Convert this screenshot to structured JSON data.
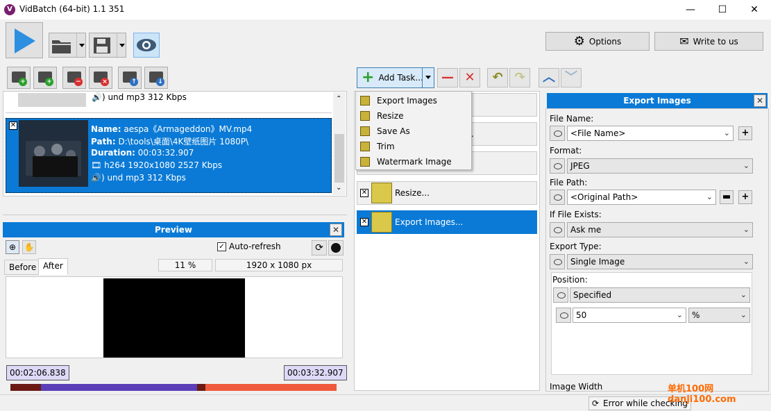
{
  "window": {
    "title": "VidBatch (64-bit) 1.1 351",
    "app_icon": "V",
    "minimize": "—",
    "maximize": "☐",
    "close": "✕"
  },
  "toolbar": {
    "options_label": "Options",
    "write_label": "Write to us"
  },
  "file_list": {
    "prev_item_audio": "🔊) und mp3 312 Kbps",
    "selected": {
      "checkbox": "✕",
      "name_label": "Name:",
      "name_value": "aespa《Armageddon》MV.mp4",
      "path_label": "Path:",
      "path_value": "D:\\tools\\桌面\\4K壁纸图片 1080P\\",
      "duration_label": "Duration:",
      "duration_value": "00:03:32.907",
      "video": "h264 1920x1080 2527 Kbps",
      "audio": "und mp3 312 Kbps"
    }
  },
  "preview": {
    "title": "Preview",
    "auto_refresh_label": "Auto-refresh",
    "zoom": "11 %",
    "resolution": "1920 x 1080 px",
    "tab_before": "Before",
    "tab_after": "After",
    "time_start": "00:02:06.838",
    "time_end": "00:03:32.907"
  },
  "tasks": {
    "add_task_label": "Add Task...",
    "menu": [
      "Export Images",
      "Resize",
      "Save As",
      "Trim",
      "Watermark Image"
    ],
    "partial_suffix": ".",
    "items": [
      {
        "label": "Resize...",
        "selected": false
      },
      {
        "label": "Export Images...",
        "selected": true
      }
    ]
  },
  "properties": {
    "title": "Export Images",
    "file_name_label": "File Name:",
    "file_name_value": "<File Name>",
    "format_label": "Format:",
    "format_value": "JPEG",
    "file_path_label": "File Path:",
    "file_path_value": "<Original Path>",
    "if_exists_label": "If File Exists:",
    "if_exists_value": "Ask me",
    "export_type_label": "Export Type:",
    "export_type_value": "Single Image",
    "position_label": "Position:",
    "position_value": "Specified",
    "position_amount": "50",
    "position_unit": "%",
    "image_width_label": "Image Width"
  },
  "status": {
    "text": "Error while checking"
  },
  "watermark": {
    "text": "单机100网 danji100.com"
  },
  "colors": {
    "accent": "#0a7ad6",
    "timeline_red": "#f05a3c",
    "timeline_purple": "#5b3fb8",
    "timeline_dark": "#6b1a14"
  }
}
